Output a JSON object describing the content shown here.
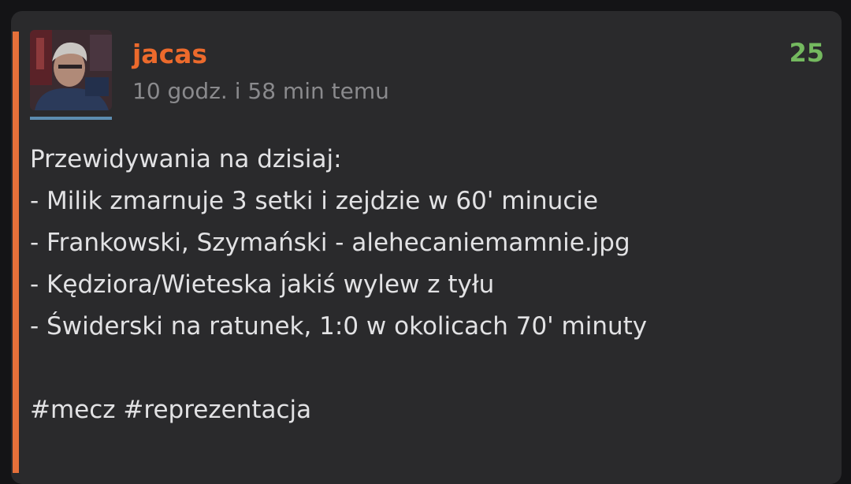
{
  "post": {
    "author": "jacas",
    "timestamp": "10 godz. i 58 min temu",
    "votes": "25",
    "lines": [
      "Przewidywania na dzisiaj:",
      "- Milik zmarnuje 3 setki i zejdzie w 60' minucie",
      "- Frankowski, Szymański - alehecaniemamnie.jpg",
      "- Kędziora/Wieteska jakiś wylew z tyłu",
      "- Świderski na ratunek, 1:0 w okolicach 70' minuty"
    ],
    "tags": [
      "#mecz",
      "#reprezentacja"
    ]
  },
  "colors": {
    "background": "#141416",
    "card": "#2a2a2c",
    "accent": "#e5703a",
    "author": "#ec6a2c",
    "votes": "#74b95f",
    "timestamp": "#8a8a8d",
    "text": "#e2e2e4"
  },
  "icons": {
    "avatar": "user-avatar-photo"
  }
}
